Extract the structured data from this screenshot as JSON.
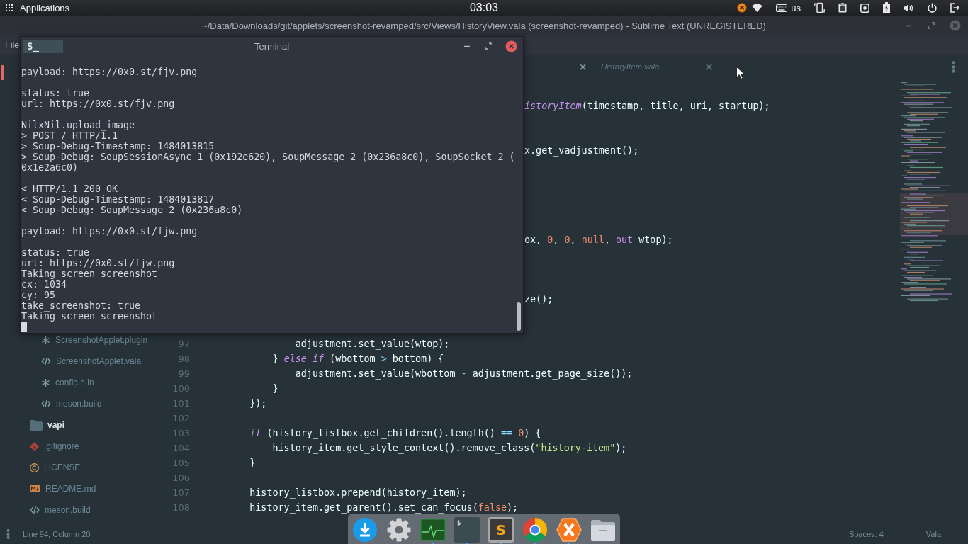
{
  "top_panel": {
    "menu_label": "Applications",
    "clock": "03:03",
    "keyboard_layout": "us"
  },
  "editor": {
    "title": "~/Data/Downloads/git/applets/screenshot-revamped/src/Views/HistoryView.vala (screenshot-revamped) - Sublime Text (UNREGISTERED)",
    "menu": [
      "File"
    ],
    "tabs": [
      {
        "selected": true
      },
      {
        "label": "HistoryItem.vala",
        "selected": false
      }
    ],
    "sidebar": {
      "items": [
        {
          "children": [
            {
              "label": "ScreenshotApplet.plugin",
              "kind": "plain"
            },
            {
              "label": "ScreenshotApplet.vala",
              "kind": "code"
            },
            {
              "label": "config.h.in",
              "kind": "plain"
            },
            {
              "label": "meson.build",
              "kind": "code"
            }
          ]
        },
        {
          "label": "vapi",
          "kind": "folder"
        },
        {
          "label": ".gitignore",
          "kind": "git"
        },
        {
          "label": "LICENSE",
          "kind": "license"
        },
        {
          "label": "README.md",
          "kind": "markdown"
        },
        {
          "label": "meson.build",
          "kind": "code"
        }
      ]
    },
    "code_lines": [
      {
        "kind": "covered"
      },
      {
        "kind": "covered",
        "segments": [
          {
            "text": "istoryItem",
            "kind": "keyword"
          },
          {
            "text": "(timestamp, title, uri, startup);",
            "kind": "plain"
          }
        ]
      },
      {
        "kind": "covered"
      },
      {
        "kind": "covered"
      },
      {
        "kind": "covered",
        "segments": [
          {
            "text": "x.get_vadjustment();",
            "kind": "plain"
          }
        ]
      },
      {
        "kind": "covered"
      },
      {
        "kind": "covered"
      },
      {
        "kind": "covered"
      },
      {
        "kind": "covered"
      },
      {
        "kind": "covered"
      },
      {
        "kind": "covered",
        "segments": [
          {
            "text": "ox, ",
            "kind": "plain"
          },
          {
            "text": "0",
            "kind": "constant"
          },
          {
            "text": ", ",
            "kind": "plain"
          },
          {
            "text": "0",
            "kind": "constant"
          },
          {
            "text": ", ",
            "kind": "plain"
          },
          {
            "text": "null",
            "kind": "constant"
          },
          {
            "text": ", ",
            "kind": "plain"
          },
          {
            "text": "out",
            "kind": "storage"
          },
          {
            "text": " wtop);",
            "kind": "plain"
          }
        ]
      },
      {
        "kind": "covered"
      },
      {
        "kind": "covered"
      },
      {
        "kind": "covered"
      },
      {
        "kind": "covered",
        "segments": [
          {
            "text": "ze();",
            "kind": "plain"
          }
        ]
      },
      {
        "kind": "covered"
      },
      {
        "kind": "covered"
      },
      {
        "kind": "full",
        "number": "97",
        "segments": [
          {
            "text": "            adjustment.set_value(wtop);",
            "kind": "plain"
          }
        ]
      },
      {
        "kind": "full",
        "number": "98",
        "segments": [
          {
            "text": "        } ",
            "kind": "plain"
          },
          {
            "text": "else if",
            "kind": "keyword"
          },
          {
            "text": " (wbottom ",
            "kind": "plain"
          },
          {
            "text": ">",
            "kind": "operator"
          },
          {
            "text": " bottom) {",
            "kind": "plain"
          }
        ]
      },
      {
        "kind": "full",
        "number": "99",
        "segments": [
          {
            "text": "            adjustment.set_value(wbottom ",
            "kind": "plain"
          },
          {
            "text": "-",
            "kind": "operator"
          },
          {
            "text": " adjustment.get_page_size());",
            "kind": "plain"
          }
        ]
      },
      {
        "kind": "full",
        "number": "100",
        "segments": [
          {
            "text": "        }",
            "kind": "plain"
          }
        ]
      },
      {
        "kind": "full",
        "number": "101",
        "segments": [
          {
            "text": "    });",
            "kind": "plain"
          }
        ]
      },
      {
        "kind": "full",
        "number": "102"
      },
      {
        "kind": "full",
        "number": "103",
        "segments": [
          {
            "text": "    if",
            "kind": "keyword"
          },
          {
            "text": " (history_listbox.get_children().length() ",
            "kind": "plain"
          },
          {
            "text": "== ",
            "kind": "operator"
          },
          {
            "text": "0",
            "kind": "constant"
          },
          {
            "text": ") {",
            "kind": "plain"
          }
        ]
      },
      {
        "kind": "full",
        "number": "104",
        "segments": [
          {
            "text": "        history_item.get_style_context().remove_class(",
            "kind": "plain"
          },
          {
            "text": "\"history-item\"",
            "kind": "string"
          },
          {
            "text": ");",
            "kind": "plain"
          }
        ]
      },
      {
        "kind": "full",
        "number": "105",
        "segments": [
          {
            "text": "    }",
            "kind": "plain"
          }
        ]
      },
      {
        "kind": "full",
        "number": "106"
      },
      {
        "kind": "full",
        "number": "107",
        "segments": [
          {
            "text": "    history_listbox.prepend(history_item);",
            "kind": "plain"
          }
        ]
      },
      {
        "kind": "full",
        "number": "108",
        "segments": [
          {
            "text": "    history_item.get_parent().set_can_focus(",
            "kind": "plain"
          },
          {
            "text": "false",
            "kind": "constant"
          },
          {
            "text": ");",
            "kind": "plain"
          }
        ]
      }
    ],
    "status_bar": {
      "position": "Line 94, Column 20",
      "indentation": "Spaces: 4",
      "syntax": "Vala"
    }
  },
  "terminal": {
    "title": "Terminal",
    "icon_text": "$_",
    "blocks": [
      [
        "payload: https://0x0.st/fjv.png"
      ],
      [
        "status: true",
        "url: https://0x0.st/fjv.png"
      ],
      [
        "NilxNil.upload_image",
        "> POST / HTTP/1.1",
        "> Soup-Debug-Timestamp: 1484013815",
        "> Soup-Debug: SoupSessionAsync 1 (0x192e620), SoupMessage 2 (0x236a8c0), SoupSocket 2 (",
        "0x1e2a6c0)"
      ],
      [
        "< HTTP/1.1 200 OK",
        "< Soup-Debug-Timestamp: 1484013817",
        "< Soup-Debug: SoupMessage 2 (0x236a8c0)"
      ],
      [
        "payload: https://0x0.st/fjw.png"
      ],
      [
        "status: true",
        "url: https://0x0.st/fjw.png",
        "Taking screen screenshot",
        "cx: 1034",
        "cy: 95",
        "take_screenshot: true",
        "Taking screen screenshot"
      ]
    ]
  },
  "dock": {
    "items": [
      {
        "kind": "download",
        "running": false
      },
      {
        "kind": "settings",
        "running": false
      },
      {
        "kind": "monitor",
        "running": true
      },
      {
        "kind": "terminal",
        "glyph": "$_",
        "running": true
      },
      {
        "kind": "editor",
        "glyph": "S",
        "running": true
      },
      {
        "kind": "browser",
        "running": true
      },
      {
        "kind": "hexagon",
        "running": true
      },
      {
        "kind": "files",
        "running": false
      }
    ]
  }
}
